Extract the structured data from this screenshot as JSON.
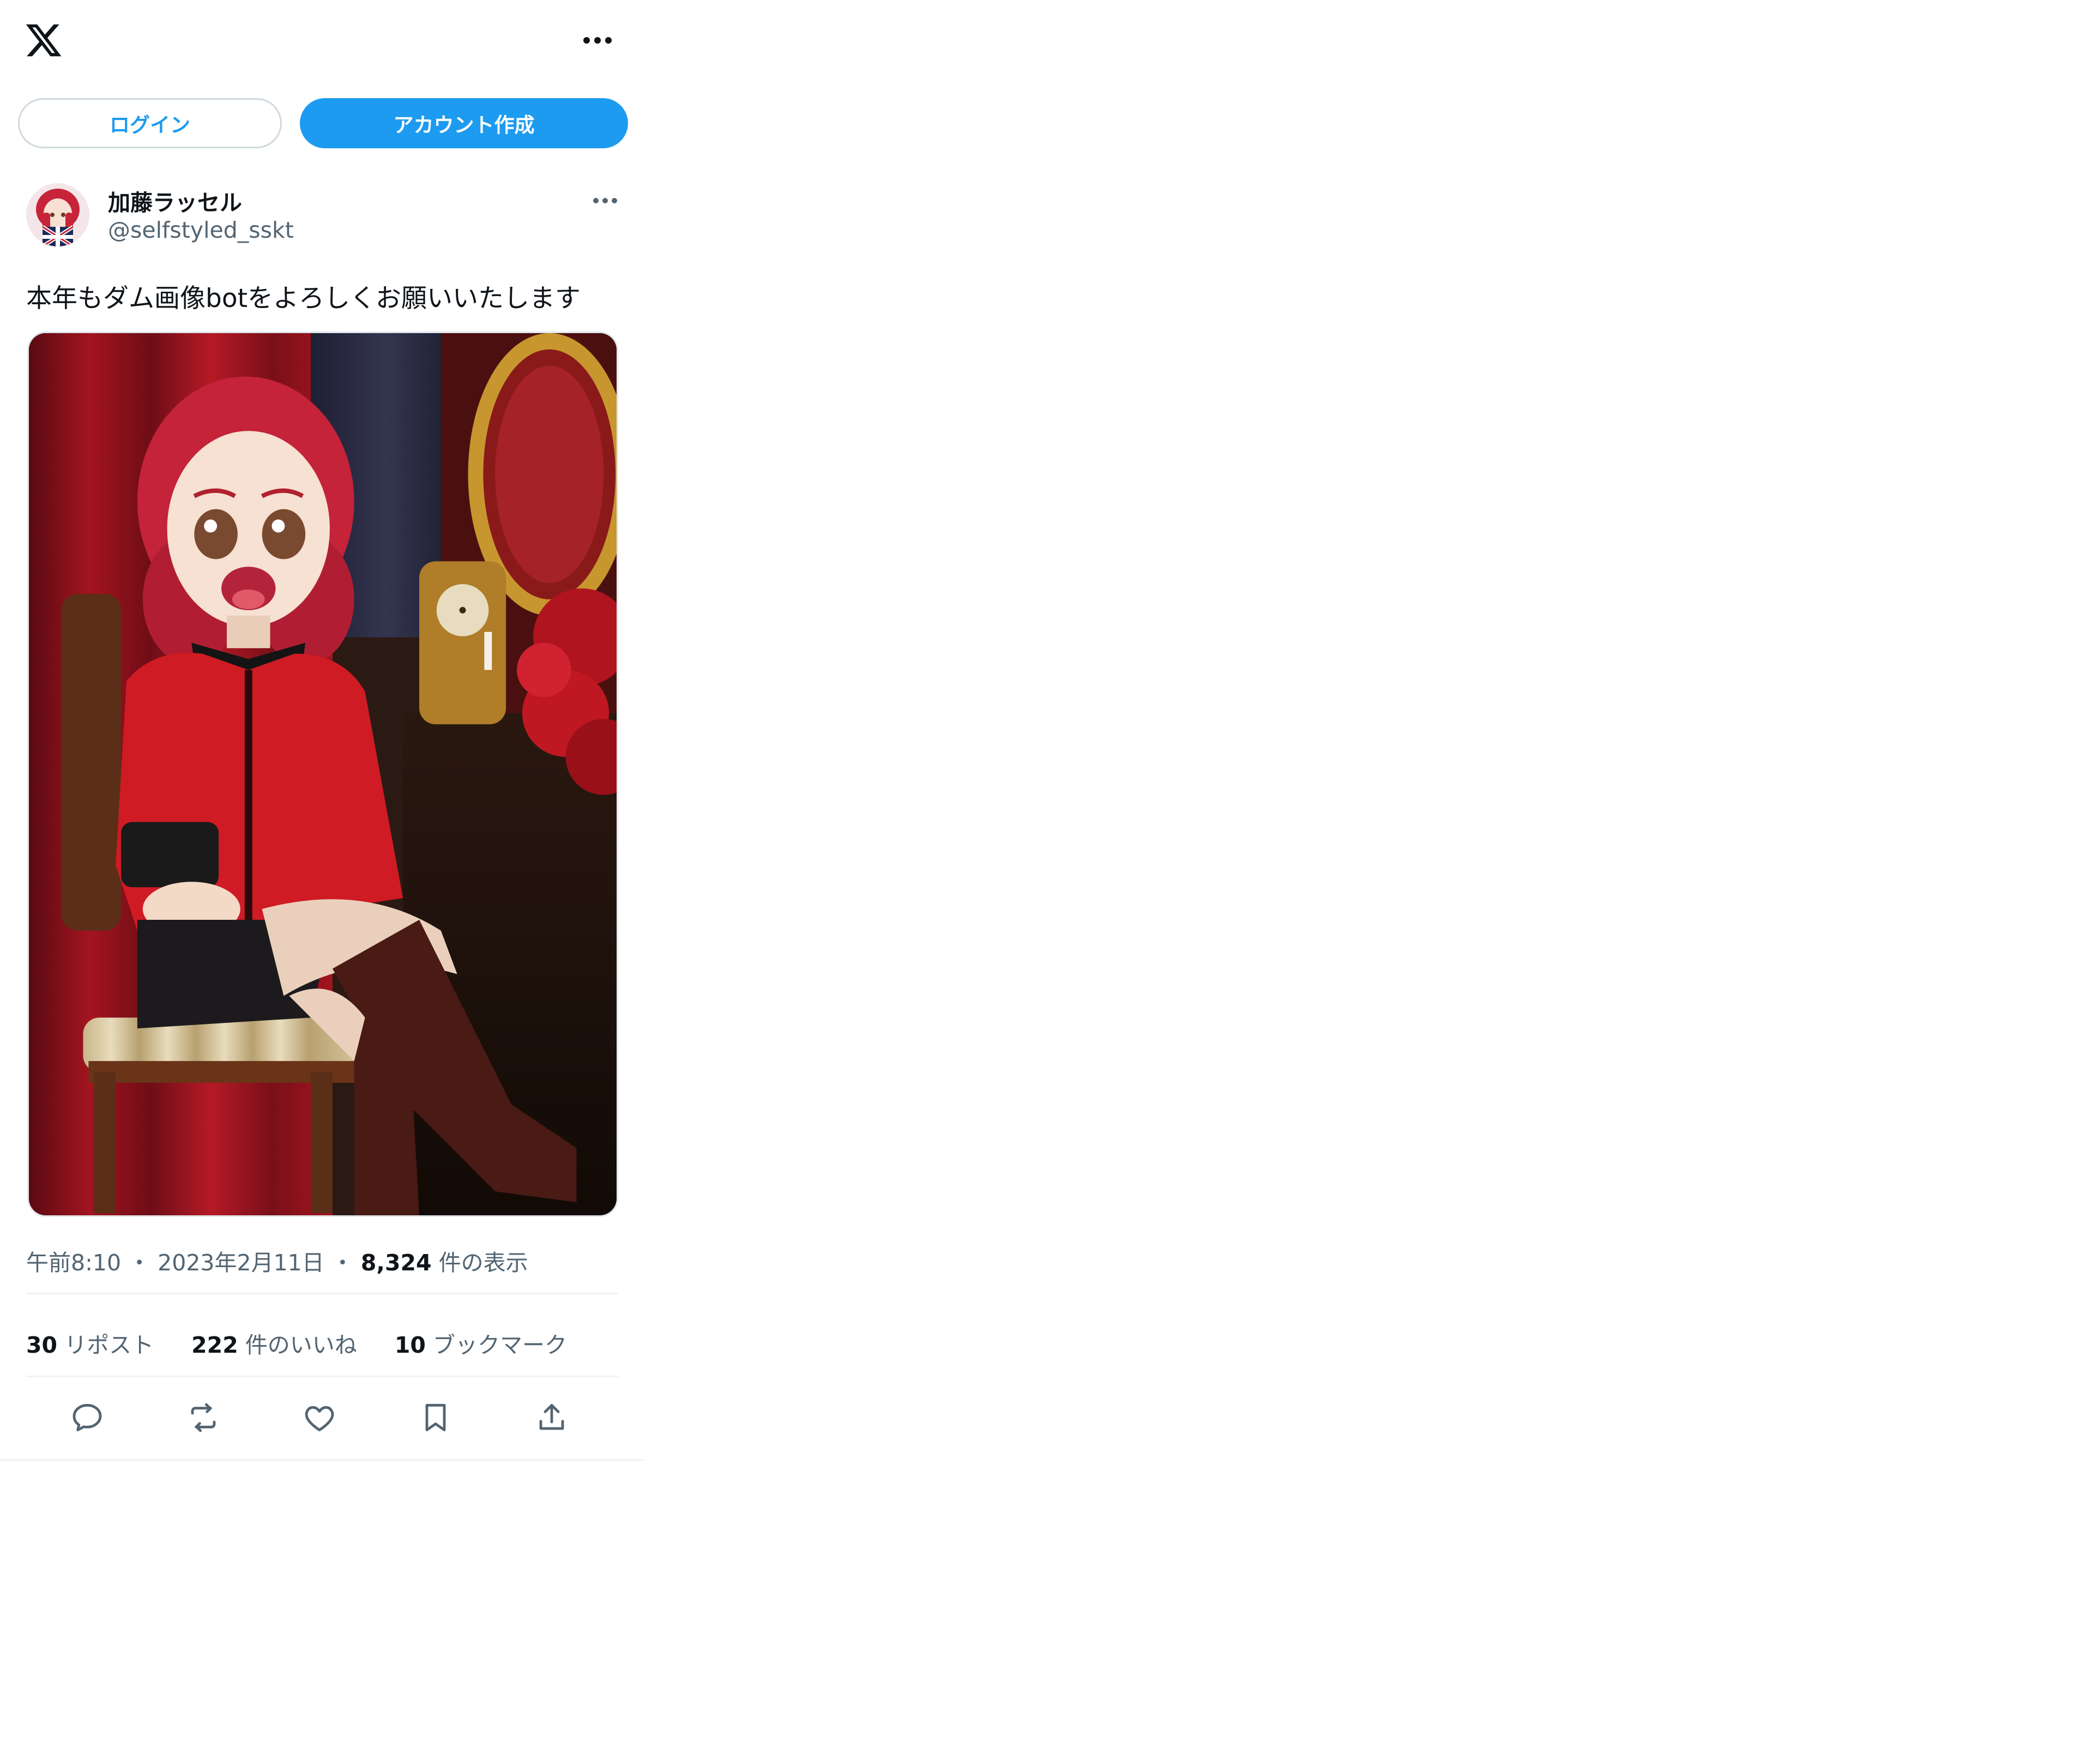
{
  "header": {
    "logo_icon": "x-logo-icon",
    "more_icon": "more-horizontal-icon"
  },
  "auth": {
    "login_label": "ログイン",
    "signup_label": "アカウント作成",
    "accent_color": "#1d9bf0"
  },
  "tweet": {
    "author_name": "加藤ラッセル",
    "author_handle": "@selfstyled_sskt",
    "text": "本年もダム画像botをよろしくお願いいたします",
    "time": "午前8:10",
    "separator": "・",
    "date": "2023年2月11日",
    "views_count": "8,324",
    "views_label": "件の表示",
    "stats": {
      "reposts_count": "30",
      "reposts_label": "リポスト",
      "likes_count": "222",
      "likes_label": "件のいいね",
      "bookmarks_count": "10",
      "bookmarks_label": "ブックマーク"
    },
    "actions": [
      "reply-icon",
      "repost-icon",
      "like-icon",
      "bookmark-icon",
      "share-icon"
    ]
  }
}
